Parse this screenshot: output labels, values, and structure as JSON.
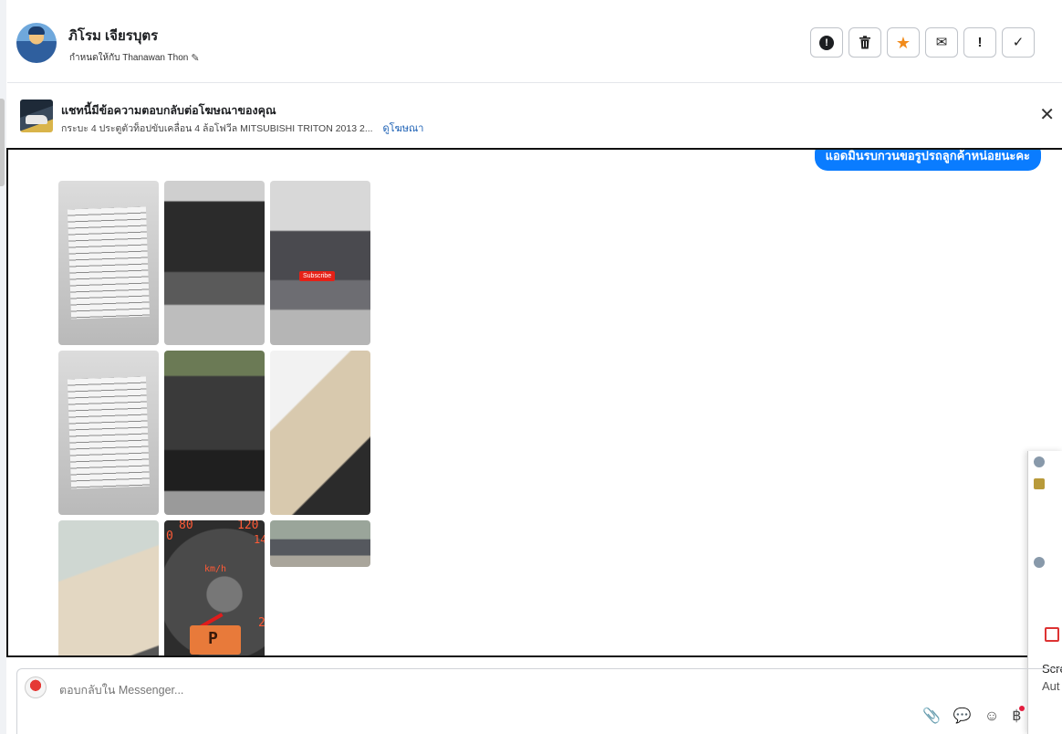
{
  "header": {
    "user_name": "ภิโรม เจียรบุตร",
    "assigned_to": "กำหนดให้กับ Thanawan Thon",
    "actions": [
      {
        "name": "alert-circle",
        "glyph": "!"
      },
      {
        "name": "trash",
        "glyph": "🗑"
      },
      {
        "name": "star",
        "glyph": "★",
        "color": "#f28b1b"
      },
      {
        "name": "envelope",
        "glyph": "✉"
      },
      {
        "name": "exclamation",
        "glyph": "!"
      },
      {
        "name": "check",
        "glyph": "✓"
      }
    ]
  },
  "banner": {
    "title": "แชทนี้มีข้อความตอบกลับต่อโฆษณาของคุณ",
    "subtitle": "กระบะ 4 ประตูตัวท็อปขับเคลื่อน 4 ล้อโฟวีล MITSUBISHI TRITON 2013 2...",
    "link": "ดูโฆษณา",
    "close": "✕"
  },
  "chat": {
    "bubble_text": "แอดมินรบกวนขอรูปรถลูกค้าหน่อยนะคะ",
    "bubble_color": "#0a7cff",
    "photo_overlay_text": "Subscribe",
    "gauge": {
      "left": "80",
      "right": "120",
      "unit": "km/h",
      "edge": "14",
      "low": "0",
      "mid": "2",
      "gear": "P"
    }
  },
  "overlay": {
    "line1": "Scre",
    "line2": "Aut"
  },
  "composer": {
    "placeholder": "ตอบกลับใน Messenger...",
    "tools": [
      "paperclip",
      "comment",
      "smile",
      "baht"
    ]
  },
  "icons": {
    "pencil": "✎",
    "paperclip": "📎",
    "comment": "💬",
    "smile": "☺",
    "baht": "฿"
  }
}
